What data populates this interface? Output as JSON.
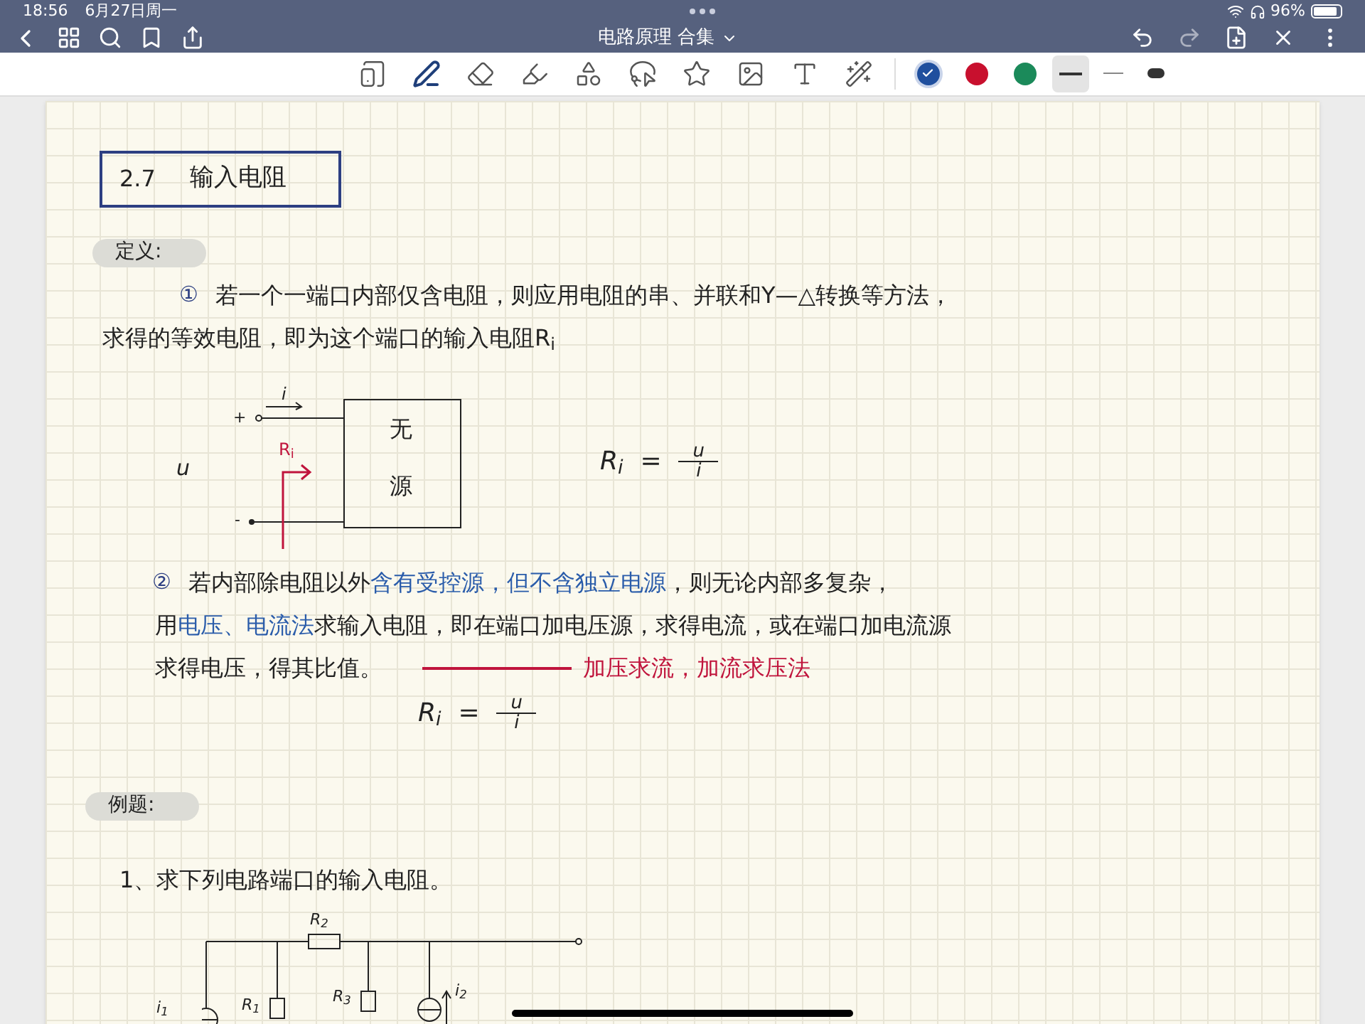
{
  "status_bar": {
    "time": "18:56",
    "date": "6月27日周一",
    "battery": "96%"
  },
  "nav_bar": {
    "title": "电路原理 合集"
  },
  "toolbar": {
    "tools": [
      {
        "kind": "pages",
        "selected": false
      },
      {
        "kind": "pen",
        "selected": true
      },
      {
        "kind": "eraser",
        "selected": false
      },
      {
        "kind": "highlighter",
        "selected": false
      },
      {
        "kind": "shapes",
        "selected": false
      },
      {
        "kind": "lasso",
        "selected": false
      },
      {
        "kind": "sticker",
        "selected": false
      },
      {
        "kind": "image",
        "selected": false
      },
      {
        "kind": "text",
        "selected": false
      },
      {
        "kind": "laser",
        "selected": false
      }
    ],
    "colors": [
      {
        "color": "#1f4f9e",
        "selected": true
      },
      {
        "color": "#c8102e",
        "selected": false
      },
      {
        "color": "#1b8a5a",
        "selected": false
      }
    ],
    "widths": [
      {
        "kind": "thick",
        "selected": true
      },
      {
        "kind": "thin",
        "selected": false
      },
      {
        "kind": "marker",
        "selected": false
      }
    ]
  },
  "note": {
    "heading": {
      "number": "2.7",
      "title": "输入电阻"
    },
    "definition_label": "定义:",
    "point_1": {
      "marker": "①",
      "lines": [
        "若一个一端口内部仅含电阻，则应用电阻的串、并联和Y—△转换等方法，",
        "求得的等效电阻，即为这个端口的输入电阻R$_{i}$"
      ]
    },
    "circuit_1": {
      "plus": "+",
      "minus": "-",
      "voltage": "u",
      "current": "i",
      "box_lines": [
        "无",
        "源"
      ],
      "resistance": "R$_{i}$"
    },
    "formula_1": {
      "lhs": "R$_{i}$",
      "equals": "=",
      "numerator": "u",
      "denominator": "i"
    },
    "point_2": {
      "marker": "②",
      "lines": [
        [
          {
            "text": "若内部除电阻以外",
            "emphasis": false
          },
          {
            "text": "含有受控源，但不含独立电源",
            "emphasis": true
          },
          {
            "text": "，则无论内部多复杂，",
            "emphasis": false
          }
        ],
        [
          {
            "text": "用",
            "emphasis": false
          },
          {
            "text": "电压、电流法",
            "emphasis": true
          },
          {
            "text": "求输入电阻，即在端口加电压源，求得电流，或在端口加电流源",
            "emphasis": false
          }
        ],
        [
          {
            "text": "求得电压，得其比值。",
            "emphasis": false
          }
        ]
      ],
      "summary": "加压求流，加流求压法"
    },
    "formula_2": {
      "lhs": "R$_{i}$",
      "equals": "=",
      "numerator": "u",
      "denominator": "i"
    },
    "example_label": "例题:",
    "problem": "1、求下列电路端口的输入电阻。",
    "circuit_2": {
      "r2": "R$_{2}$",
      "r1": "R$_{1}$",
      "r3": "R$_{3}$",
      "i1": "i$_{1}$",
      "i2": "i$_{2}$"
    }
  }
}
